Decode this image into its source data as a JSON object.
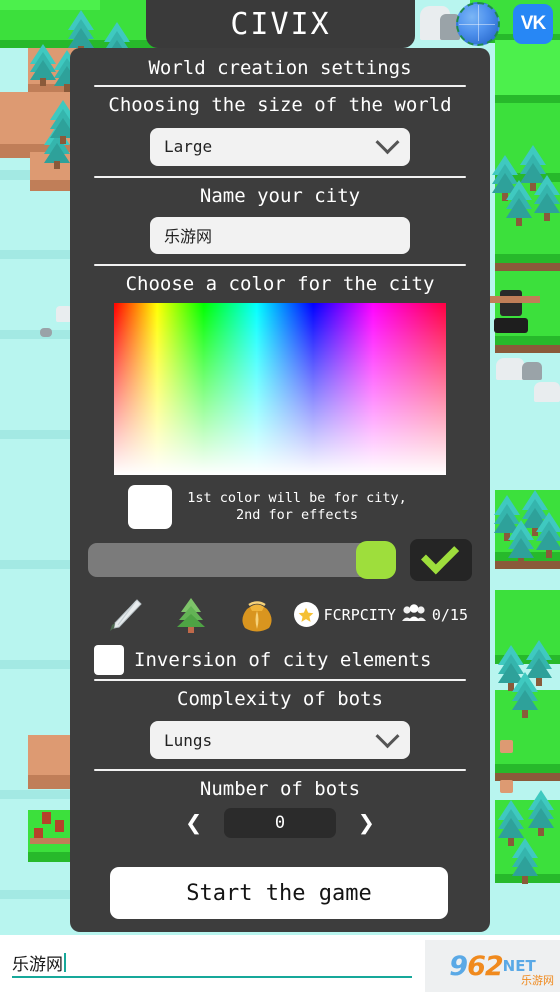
{
  "app": {
    "title": "CIVIX"
  },
  "topbar": {
    "globe_icon": "globe-icon",
    "vk_label": "VK"
  },
  "panel": {
    "heading": "World creation settings",
    "size_section": {
      "label": "Choosing the size of the world",
      "value": "Large",
      "chevron_icon": "chevron-down-icon"
    },
    "name_section": {
      "label": "Name your city",
      "value": "乐游网"
    },
    "color_section": {
      "label": "Choose a color for the city",
      "swatch_color": "#ffffff",
      "note": "1st color will be for city, 2nd for effects",
      "slider_value": 100,
      "slider_thumb_color": "#9ede3c",
      "confirm_icon": "checkmark-icon"
    },
    "icons": [
      {
        "name": "sword-icon"
      },
      {
        "name": "tree-icon"
      },
      {
        "name": "money-bag-icon"
      }
    ],
    "server": {
      "star_icon": "star-icon",
      "name": "FCRPCITY",
      "players_icon": "players-icon",
      "players": "0/15"
    },
    "inversion": {
      "label": "Inversion of city elements",
      "checked": false
    },
    "complexity_section": {
      "label": "Complexity of bots",
      "value": "Lungs",
      "chevron_icon": "chevron-down-icon"
    },
    "bots_section": {
      "label": "Number of bots",
      "value": "0",
      "prev_icon": "chevron-left-icon",
      "next_icon": "chevron-right-icon"
    },
    "start_button": "Start the game"
  },
  "bottom": {
    "input_value": "乐游网",
    "watermark": {
      "num": "962",
      "net": "NET",
      "cn": "乐游网"
    }
  },
  "colors": {
    "panel_bg": "#3d3d3d",
    "accent_green": "#9ede3c",
    "input_bg": "#f2f2f2",
    "underline": "#17a89a"
  }
}
